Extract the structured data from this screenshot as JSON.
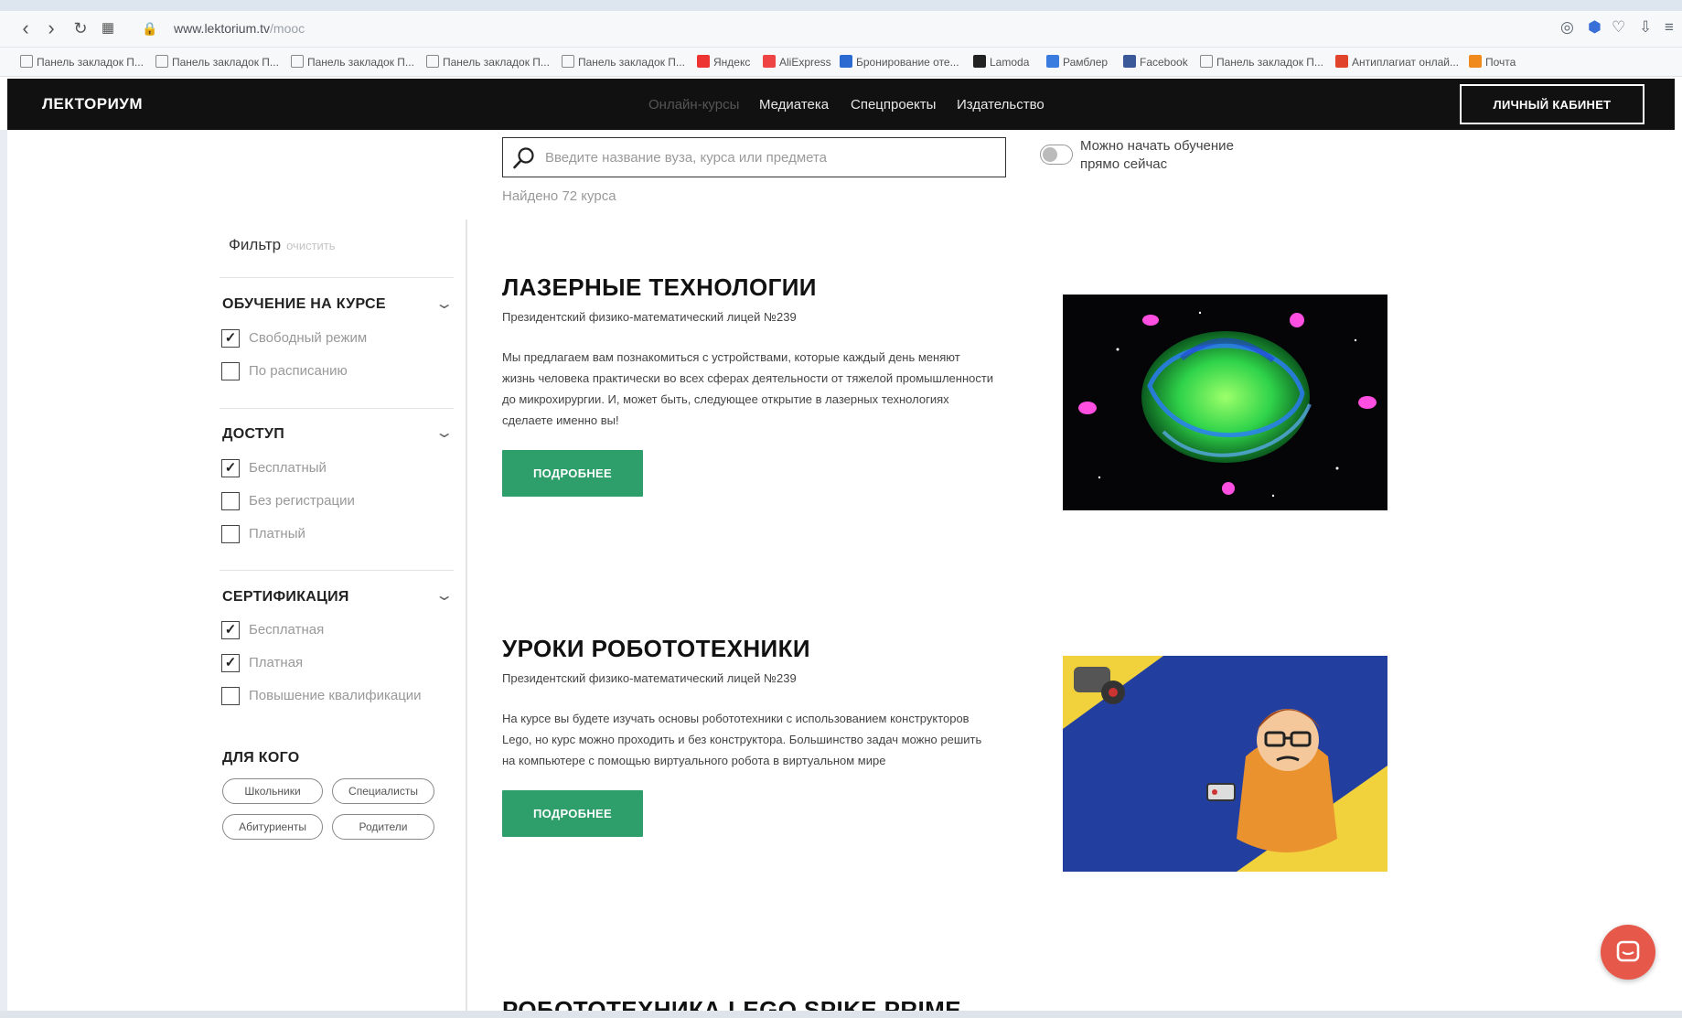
{
  "browser": {
    "url_host": "www.lektorium.tv",
    "url_path": "/mooc",
    "bookmarks": [
      "Панель закладок П...",
      "Панель закладок П...",
      "Панель закладок П...",
      "Панель закладок П...",
      "Панель закладок П...",
      "Яндекс",
      "AliExpress",
      "Бронирование оте...",
      "Lamoda",
      "Рамблер",
      "Facebook",
      "Панель закладок П...",
      "Антиплагиат онлай...",
      "Почта"
    ]
  },
  "header": {
    "logo": "ЛЕКТОРИУМ",
    "nav": [
      "Онлайн-курсы",
      "Медиатека",
      "Спецпроекты",
      "Издательство"
    ],
    "cabinet": "ЛИЧНЫЙ КАБИНЕТ"
  },
  "search": {
    "placeholder": "Введите название вуза, курса или предмета",
    "toggle_label": "Можно начать обучение прямо сейчас",
    "found": "Найдено 72 курса"
  },
  "filter": {
    "title": "Фильтр",
    "clear": "очистить",
    "sections": [
      {
        "title": "ОБУЧЕНИЕ НА КУРСЕ",
        "options": [
          {
            "label": "Свободный режим",
            "checked": true
          },
          {
            "label": "По расписанию",
            "checked": false
          }
        ]
      },
      {
        "title": "ДОСТУП",
        "options": [
          {
            "label": "Бесплатный",
            "checked": true
          },
          {
            "label": "Без регистрации",
            "checked": false
          },
          {
            "label": "Платный",
            "checked": false
          }
        ]
      },
      {
        "title": "СЕРТИФИКАЦИЯ",
        "options": [
          {
            "label": "Бесплатная",
            "checked": true
          },
          {
            "label": "Платная",
            "checked": true
          },
          {
            "label": "Повышение квалификации",
            "checked": false
          }
        ]
      }
    ],
    "audience_title": "ДЛЯ КОГО",
    "audience": [
      "Школьники",
      "Специалисты",
      "Абитуриенты",
      "Родители"
    ]
  },
  "courses": [
    {
      "title": "ЛАЗЕРНЫЕ ТЕХНОЛОГИИ",
      "school": "Президентский физико-математический лицей №239",
      "description": "Мы предлагаем вам познакомиться с устройствами, которые каждый день меняют жизнь человека практически во всех сферах деятельности от тяжелой промышленности до микрохирургии. И, может быть, следующее открытие в лазерных технологиях сделаете именно вы!",
      "button": "ПОДРОБНЕЕ"
    },
    {
      "title": "УРОКИ РОБОТОТЕХНИКИ",
      "school": "Президентский физико-математический лицей №239",
      "description": "На курсе вы будете изучать основы робототехники с использованием конструкторов Lego, но курс можно проходить и без конструктора. Большинство задач можно решить на компьютере с помощью виртуального робота в виртуальном мире",
      "button": "ПОДРОБНЕЕ"
    },
    {
      "title": "РОБОТОТЕХНИКА LEGO SPIKE PRIME"
    }
  ],
  "colors": {
    "accent": "#2e9e6b",
    "header_bg": "#111111",
    "chat": "#e5584a"
  }
}
